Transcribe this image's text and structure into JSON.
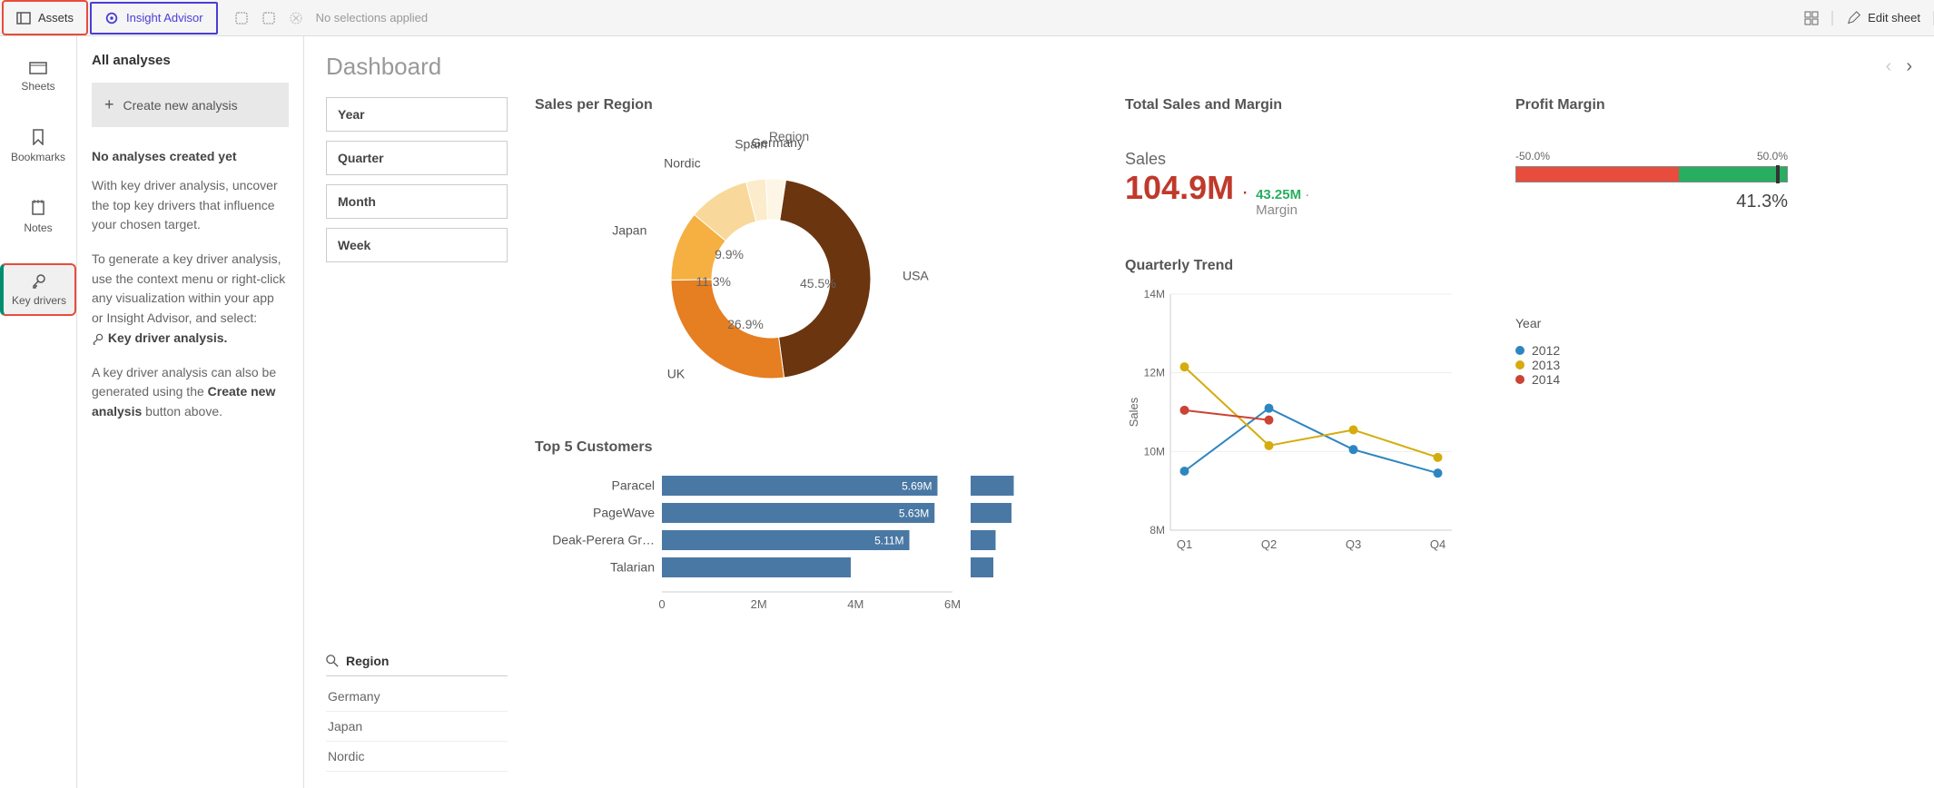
{
  "toolbar": {
    "assets": "Assets",
    "insight": "Insight Advisor",
    "no_selections": "No selections applied",
    "edit_sheet": "Edit sheet"
  },
  "rail": {
    "sheets": "Sheets",
    "bookmarks": "Bookmarks",
    "notes": "Notes",
    "key_drivers": "Key drivers"
  },
  "panel": {
    "title": "All analyses",
    "create": "Create new analysis",
    "heading": "No analyses created yet",
    "p1": "With key driver analysis, uncover the top key drivers that influence your chosen target.",
    "p2a": "To generate a key driver analysis, use the context menu or right-click any visualization within your app or Insight Advisor, and select:",
    "p2b": "Key driver analysis.",
    "p3a": "A key driver analysis can also be generated using the ",
    "p3b": "Create new analysis",
    "p3c": " button above."
  },
  "dashboard": {
    "title": "Dashboard"
  },
  "filters": {
    "year": "Year",
    "quarter": "Quarter",
    "month": "Month",
    "week": "Week",
    "region_label": "Region",
    "regions": [
      "Germany",
      "Japan",
      "Nordic"
    ]
  },
  "kpi": {
    "title": "Total Sales and Margin",
    "label": "Sales",
    "value": "104.9M",
    "sub_value": "43.25M",
    "sub_label": "Margin"
  },
  "gauge": {
    "title": "Profit Margin",
    "min": "-50.0%",
    "max": "50.0%",
    "value": "41.3%"
  },
  "chart_data": [
    {
      "type": "pie",
      "title": "Sales per Region",
      "legend_label": "Region",
      "series": [
        {
          "name": "USA",
          "value": 45.5,
          "color": "#6b3510"
        },
        {
          "name": "UK",
          "value": 26.9,
          "color": "#e67e22"
        },
        {
          "name": "Japan",
          "value": 11.3,
          "color": "#f5b041"
        },
        {
          "name": "Nordic",
          "value": 9.9,
          "color": "#f8d99b"
        },
        {
          "name": "Spain",
          "value": 3.2,
          "color": "#fceccc"
        },
        {
          "name": "Germany",
          "value": 3.2,
          "color": "#fdf6e6"
        }
      ]
    },
    {
      "type": "bar",
      "title": "Top 5 Customers",
      "xmax": 6000000,
      "ticks": [
        "0",
        "2M",
        "4M",
        "6M"
      ],
      "series": [
        {
          "name": "Paracel",
          "value": 5690000,
          "label": "5.69M",
          "mini": 0.95
        },
        {
          "name": "PageWave",
          "value": 5630000,
          "label": "5.63M",
          "mini": 0.9
        },
        {
          "name": "Deak-Perera Gr…",
          "value": 5110000,
          "label": "5.11M",
          "mini": 0.55
        },
        {
          "name": "Talarian",
          "value": 3900000,
          "label": "",
          "mini": 0.5
        }
      ]
    },
    {
      "type": "line",
      "title": "Quarterly Trend",
      "xlabel": "",
      "ylabel": "Sales",
      "categories": [
        "Q1",
        "Q2",
        "Q3",
        "Q4"
      ],
      "ylim": [
        8000000,
        14000000
      ],
      "yticks": [
        "8M",
        "10M",
        "12M",
        "14M"
      ],
      "legend_title": "Year",
      "series": [
        {
          "name": "2012",
          "color": "#2e86c1",
          "values": [
            9500000,
            11100000,
            10050000,
            9450000
          ]
        },
        {
          "name": "2013",
          "color": "#d4ac0d",
          "values": [
            12150000,
            10150000,
            10550000,
            9850000
          ]
        },
        {
          "name": "2014",
          "color": "#cb4335",
          "values": [
            11050000,
            10800000,
            null,
            null
          ]
        }
      ]
    }
  ]
}
